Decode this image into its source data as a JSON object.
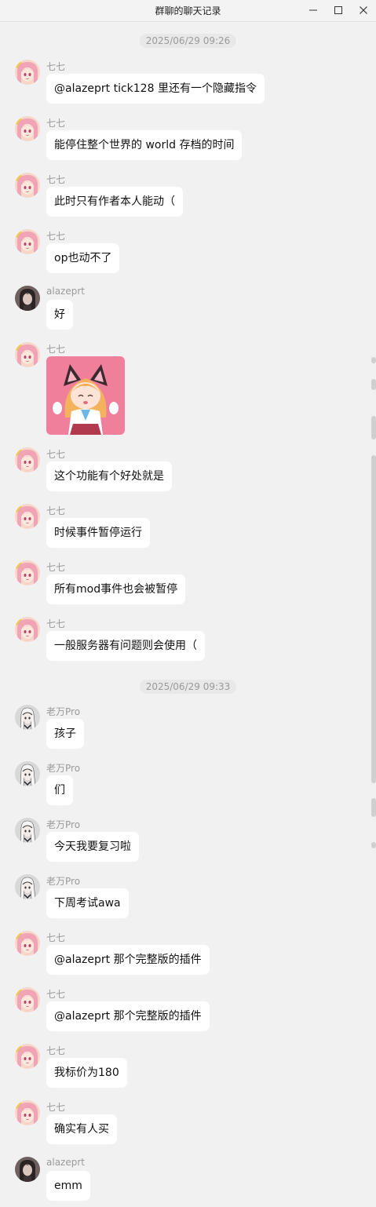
{
  "window": {
    "title": "群聊的聊天记录"
  },
  "timestamps": [
    "2025/06/29 09:26",
    "2025/06/29 09:33"
  ],
  "messages": [
    {
      "sender": "七七",
      "text": "@alazeprt  tick128 里还有一个隐藏指令"
    },
    {
      "sender": "七七",
      "text": "能停住整个世界的 world 存档的时间"
    },
    {
      "sender": "七七",
      "text": "此时只有作者本人能动（"
    },
    {
      "sender": "七七",
      "text": "op也动不了"
    },
    {
      "sender": "alazeprt",
      "text": "好"
    },
    {
      "sender": "七七",
      "text": "",
      "sticker": "anime-girl-sticker"
    },
    {
      "sender": "七七",
      "text": "这个功能有个好处就是"
    },
    {
      "sender": "七七",
      "text": "时候事件暂停运行"
    },
    {
      "sender": "七七",
      "text": "所有mod事件也会被暂停"
    },
    {
      "sender": "七七",
      "text": "一般服务器有问题则会使用（"
    },
    {
      "sender": "老万Pro",
      "text": "孩子"
    },
    {
      "sender": "老万Pro",
      "text": "们"
    },
    {
      "sender": "老万Pro",
      "text": "今天我要复习啦"
    },
    {
      "sender": "老万Pro",
      "text": "下周考试awa"
    },
    {
      "sender": "七七",
      "text": "@alazeprt 那个完整版的插件"
    },
    {
      "sender": "七七",
      "text": "@alazeprt 那个完整版的插件"
    },
    {
      "sender": "七七",
      "text": "我标价为180"
    },
    {
      "sender": "七七",
      "text": "确实有人买"
    },
    {
      "sender": "alazeprt",
      "text": "emm"
    }
  ],
  "colors": {
    "background": "#f1f1f1",
    "bubble": "#ffffff",
    "sender_text": "#9a9a9a",
    "message_text": "#111111",
    "timestamp_bg": "#e8e8e8"
  }
}
